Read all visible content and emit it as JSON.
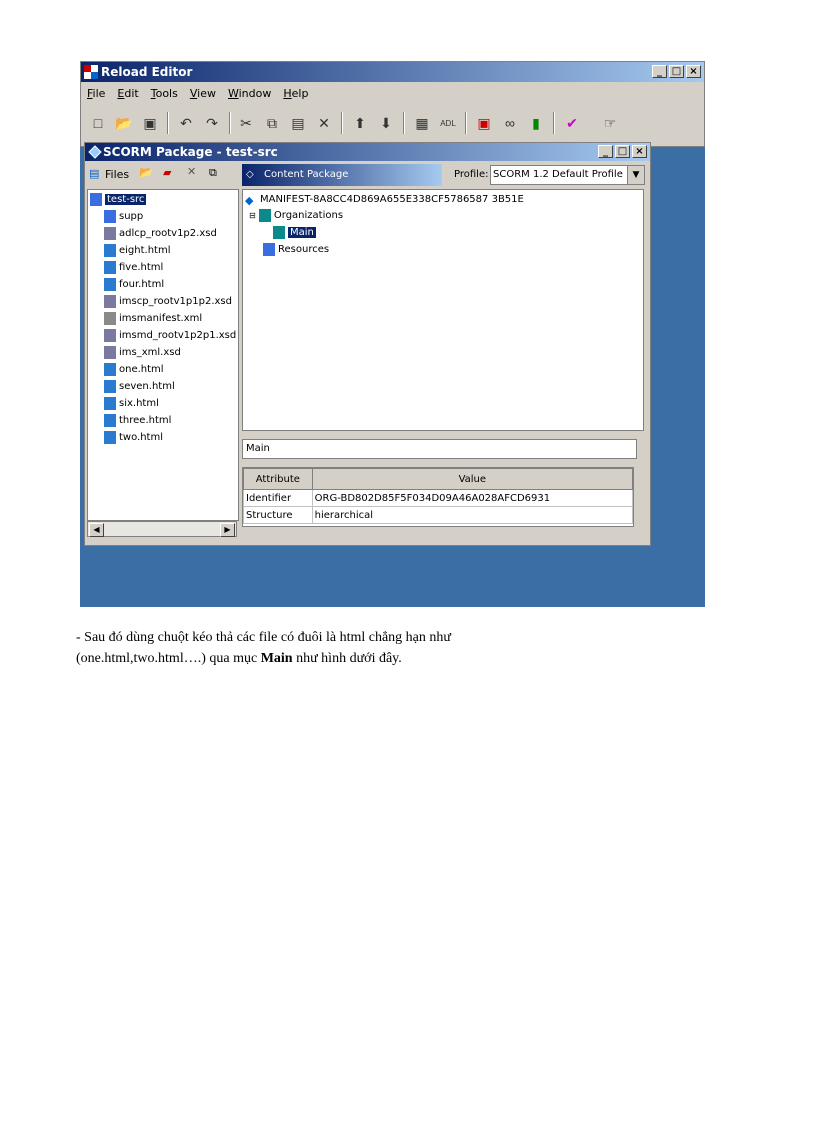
{
  "window": {
    "title": "Reload Editor",
    "buttons": [
      "_",
      "□",
      "×"
    ]
  },
  "menu": [
    "File",
    "Edit",
    "Tools",
    "View",
    "Window",
    "Help"
  ],
  "toolbar": {
    "icons": [
      "new-icon",
      "open-icon",
      "save-icon",
      "undo-icon",
      "redo-icon",
      "cut-icon",
      "copy-icon",
      "paste-icon",
      "delete-icon",
      "up-icon",
      "down-icon",
      "manifest-icon",
      "adl-icon",
      "preview-icon",
      "glasses-icon",
      "book-icon",
      "validate-icon",
      "pointer-icon"
    ]
  },
  "package_window": {
    "title": "SCORM Package - test-src"
  },
  "files_pane": {
    "label": "Files",
    "root": "test-src",
    "items": [
      {
        "name": "supp",
        "type": "folder"
      },
      {
        "name": "adlcp_rootv1p2.xsd",
        "type": "xsd"
      },
      {
        "name": "eight.html",
        "type": "html"
      },
      {
        "name": "five.html",
        "type": "html"
      },
      {
        "name": "four.html",
        "type": "html"
      },
      {
        "name": "imscp_rootv1p1p2.xsd",
        "type": "xsd"
      },
      {
        "name": "imsmanifest.xml",
        "type": "xml"
      },
      {
        "name": "imsmd_rootv1p2p1.xsd",
        "type": "xsd"
      },
      {
        "name": "ims_xml.xsd",
        "type": "xsd"
      },
      {
        "name": "one.html",
        "type": "html"
      },
      {
        "name": "seven.html",
        "type": "html"
      },
      {
        "name": "six.html",
        "type": "html"
      },
      {
        "name": "three.html",
        "type": "html"
      },
      {
        "name": "two.html",
        "type": "html"
      }
    ]
  },
  "content_pane": {
    "tab": "Content Package",
    "profile_label": "Profile:",
    "profile_value": "SCORM 1.2 Default Profile",
    "manifest": "MANIFEST-8A8CC4D869A655E338CF5786587 3B51E",
    "organizations": "Organizations",
    "main": "Main",
    "resources": "Resources"
  },
  "name_field": "Main",
  "attributes": {
    "headers": [
      "Attribute",
      "Value"
    ],
    "rows": [
      [
        "Identifier",
        "ORG-BD802D85F5F034D09A46A028AFCD6931"
      ],
      [
        "Structure",
        "hierarchical"
      ]
    ]
  },
  "caption": {
    "line1": "- Sau đó dùng chuột kéo thả các file có đuôi là html chẳng hạn như",
    "line2_pre": "(one.html,two.html….) qua mục ",
    "line2_bold": "Main",
    "line2_post": " như hình dưới đây."
  }
}
